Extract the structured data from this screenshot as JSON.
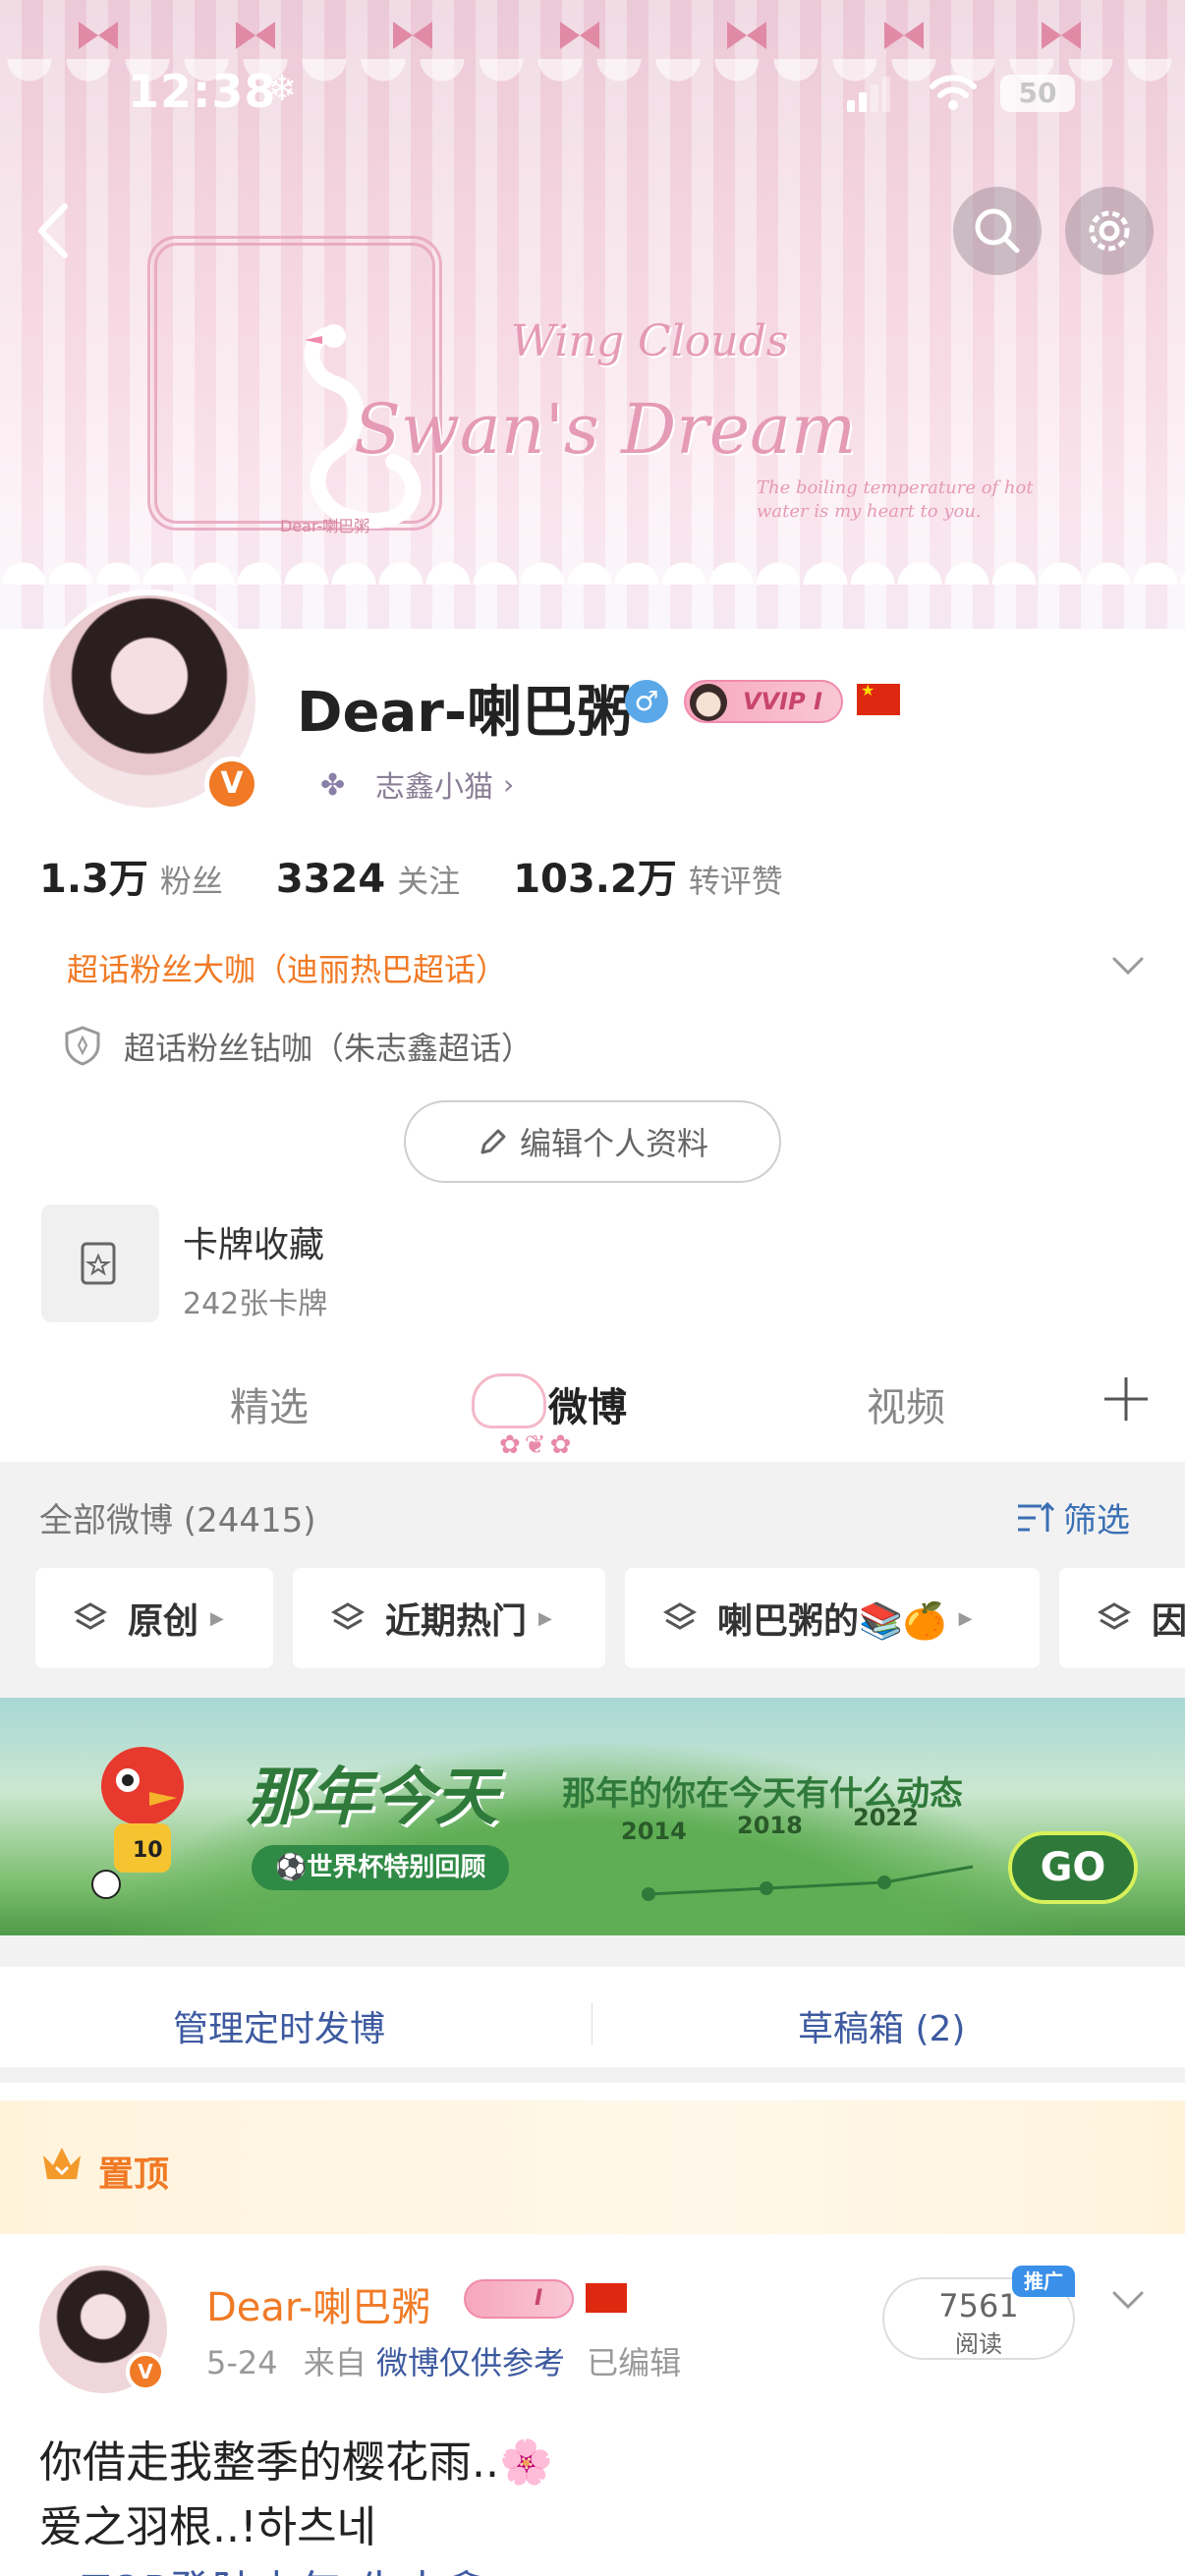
{
  "status_bar": {
    "time": "12:38",
    "weather_glyph": "❄",
    "battery": "50"
  },
  "banner": {
    "title": "Swan's Dream",
    "subtitle": "Wing Clouds",
    "tag": "Dear-喇巴粥",
    "note": "The boiling temperature of hot water is my heart to you."
  },
  "profile": {
    "username": "Dear-喇巴粥",
    "vip_label": "VVIP I",
    "group_label": "志鑫小猫",
    "stats": [
      {
        "num": "1.3万",
        "label": "粉丝"
      },
      {
        "num": "3324",
        "label": "关注"
      },
      {
        "num": "103.2万",
        "label": "转评赞"
      }
    ],
    "super_topic_1": "超话粉丝大咖（迪丽热巴超话）",
    "super_topic_2": "超话粉丝钻咖（朱志鑫超话）",
    "edit_label": "编辑个人资料",
    "card_title": "卡牌收藏",
    "card_sub": "242张卡牌"
  },
  "tabs": [
    {
      "label": "精选"
    },
    {
      "label": "微博"
    },
    {
      "label": "视频"
    }
  ],
  "feed": {
    "all_label": "全部微博 (24415)",
    "filter_label": "筛选",
    "chips": [
      {
        "label": "原创"
      },
      {
        "label": "近期热门"
      },
      {
        "label": "喇巴粥的📚🍊"
      },
      {
        "label": "因"
      }
    ]
  },
  "promo": {
    "title": "那年今天",
    "subtitle": "那年的你在今天有什么动态",
    "pill": "⚽世界杯特别回顾",
    "years": [
      "2014",
      "2018",
      "2022"
    ],
    "go": "GO"
  },
  "manage": {
    "left": "管理定时发博",
    "right": "草稿箱 (2)"
  },
  "pinned": {
    "label": "置顶",
    "author": "Dear-喇巴粥",
    "vip_label": "I",
    "date": "5-24",
    "source_prefix": "来自",
    "source": "微博仅供参考",
    "edited": "已编辑",
    "reads": "7561",
    "reads_label": "阅读",
    "promo_tag": "推广",
    "text_line_1": "你借走我整季的樱花雨..🌸",
    "text_line_2": "爱之羽根..!하츠네",
    "text_line_3": "@TOP登陆少年-朱志鑫"
  },
  "colors": {
    "accent_orange": "#f07a25",
    "link_blue": "#3d5aa0",
    "pink": "#e59ab5"
  }
}
